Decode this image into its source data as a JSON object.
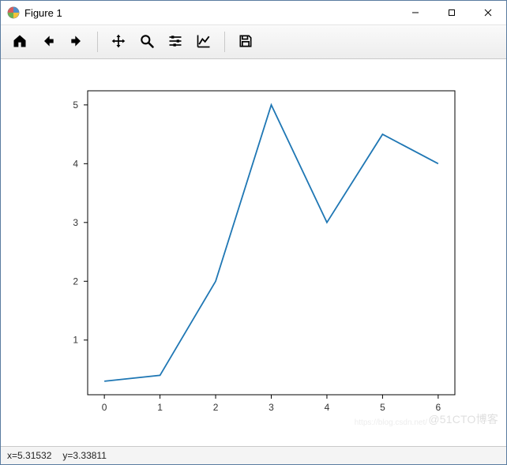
{
  "window": {
    "title": "Figure 1"
  },
  "toolbar": {
    "home": "Home",
    "back": "Back",
    "forward": "Forward",
    "pan": "Pan",
    "zoom": "Zoom",
    "subplots": "Configure subplots",
    "edit": "Edit axis, curve and image parameters",
    "save": "Save"
  },
  "status": {
    "xlabel": "x=5.31532",
    "ylabel": "y=3.33811"
  },
  "watermarks": {
    "primary": "@51CTO博客",
    "secondary": "https://blog.csdn.net/"
  },
  "chart_data": {
    "type": "line",
    "x": [
      0,
      1,
      2,
      3,
      4,
      5,
      6
    ],
    "y": [
      0.3,
      0.4,
      2.0,
      5.0,
      3.0,
      4.5,
      4.0
    ],
    "xticks": [
      0,
      1,
      2,
      3,
      4,
      5,
      6
    ],
    "yticks": [
      1,
      2,
      3,
      4,
      5
    ],
    "xlim": [
      -0.3,
      6.3
    ],
    "ylim": [
      0.07,
      5.24
    ],
    "line_color": "#1f77b4"
  }
}
